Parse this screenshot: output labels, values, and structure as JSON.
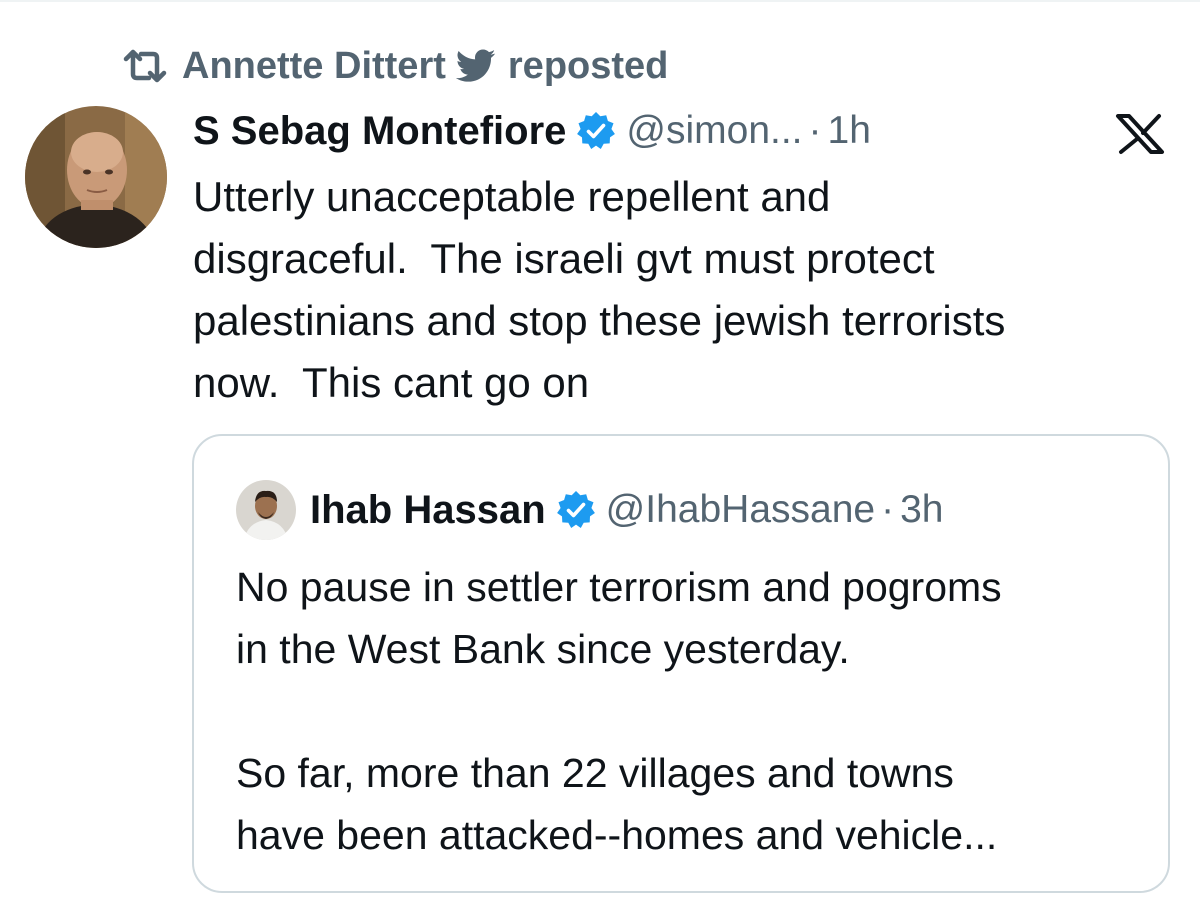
{
  "repost": {
    "reposter_name": "Annette Dittert",
    "action_label": "reposted"
  },
  "tweet": {
    "display_name": "S Sebag Montefiore",
    "handle": "@simon...",
    "separator": "·",
    "time": "1h",
    "text": "Utterly unacceptable repellent and\ndisgraceful.  The israeli gvt must protect\npalestinians and stop these jewish terrorists\nnow.  This cant go on"
  },
  "quoted_tweet": {
    "display_name": "Ihab Hassan",
    "handle": "@IhabHassane",
    "separator": "·",
    "time": "3h",
    "text": "No pause in settler terrorism and pogroms\nin the West Bank since yesterday.\n\nSo far, more than 22 villages and towns\nhave been attacked--homes and vehicle..."
  },
  "icons": {
    "repost": "repost-icon",
    "bird": "twitter-bird-icon",
    "verified": "verified-badge-icon",
    "platform_logo": "x-logo-icon"
  },
  "colors": {
    "text_primary": "#0f1419",
    "text_secondary": "#536471",
    "verified_blue": "#1d9bf0",
    "border": "#cfd9de"
  }
}
